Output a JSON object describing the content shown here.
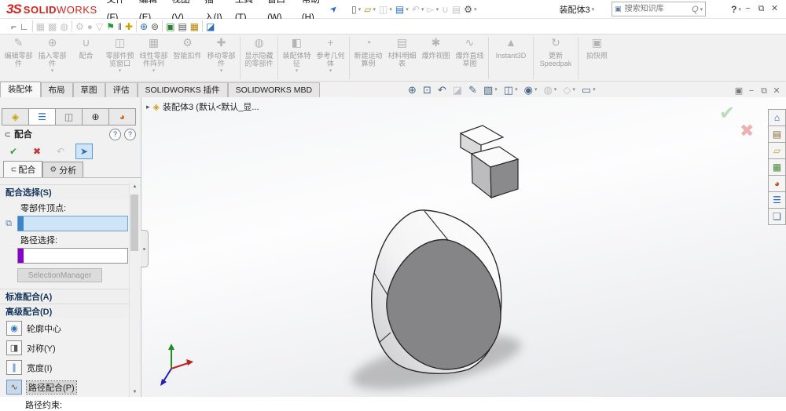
{
  "titlebar": {
    "logo_mark": "3S",
    "logo_text_solid": "SOLID",
    "logo_text_works": "WORKS",
    "menus": [
      "文件(F)",
      "编辑(E)",
      "视图(V)",
      "插入(I)",
      "工具(T)",
      "窗口(W)",
      "帮助(H)"
    ],
    "pin_glyph": "➤",
    "dropdown_glyph": "▾",
    "doc_button": "装配体3",
    "help_glyph": "?",
    "search": {
      "shield_glyph": "▣",
      "placeholder": "搜索知识库",
      "magnifier_glyph": "Q"
    },
    "quick_access": [
      {
        "name": "new-file-icon",
        "glyph": "▯",
        "color": "#666666",
        "dropdown": true
      },
      {
        "name": "open-file-icon",
        "glyph": "▱",
        "color": "#b8860b",
        "dropdown": true
      },
      {
        "name": "save-icon",
        "glyph": "◫",
        "disabled": true,
        "dropdown": true
      },
      {
        "name": "print-icon",
        "glyph": "▤",
        "color": "#2a6fb8",
        "dropdown": true
      },
      {
        "name": "undo-icon",
        "glyph": "↶",
        "disabled": true,
        "dropdown": true
      },
      {
        "name": "select-icon",
        "glyph": "▻",
        "disabled": true,
        "dropdown": true
      },
      {
        "name": "attach-icon",
        "glyph": "∪",
        "disabled": true
      },
      {
        "name": "properties-icon",
        "glyph": "▤",
        "disabled": true
      },
      {
        "name": "options-gear-icon",
        "glyph": "⚙",
        "color": "#555555",
        "dropdown": true
      }
    ],
    "window_controls": [
      {
        "name": "minimize-icon",
        "glyph": "−"
      },
      {
        "name": "restore-icon",
        "glyph": "⧉"
      },
      {
        "name": "close-icon",
        "glyph": "✕"
      }
    ]
  },
  "toolbar2": {
    "icons": [
      {
        "name": "mate-key-icon",
        "glyph": "⌐",
        "color": "#444444"
      },
      {
        "name": "angle-icon",
        "glyph": "∟",
        "color": "#444444"
      },
      {
        "sep": true
      },
      {
        "name": "component-icon",
        "glyph": "▦",
        "disabled": true
      },
      {
        "name": "pattern-icon",
        "glyph": "▩",
        "disabled": true
      },
      {
        "name": "sphere-icon",
        "glyph": "◍",
        "disabled": true
      },
      {
        "sep": true
      },
      {
        "name": "gear-icon",
        "glyph": "⚙",
        "disabled": true
      },
      {
        "name": "ball-icon",
        "glyph": "●",
        "disabled": true
      },
      {
        "name": "filter-icon",
        "glyph": "▽",
        "disabled": true
      },
      {
        "name": "location-pin-icon",
        "glyph": "⚑",
        "color": "#1f9d3a"
      },
      {
        "name": "measure-icon",
        "glyph": "‖",
        "color": "#555555"
      },
      {
        "name": "move-icon",
        "glyph": "✚",
        "color": "#c8a000"
      },
      {
        "sep": true
      },
      {
        "name": "zoom-icon",
        "glyph": "⊕",
        "color": "#2a6fb8"
      },
      {
        "name": "binoculars-icon",
        "glyph": "⊚",
        "color": "#555555"
      },
      {
        "sep": true
      },
      {
        "name": "export-icon",
        "glyph": "▣",
        "color": "#2e7d32"
      },
      {
        "name": "print-preview-icon",
        "glyph": "▤",
        "color": "#555555"
      },
      {
        "name": "image-icon",
        "glyph": "▦",
        "color": "#b8860b"
      },
      {
        "sep": true
      },
      {
        "name": "save-view-icon",
        "glyph": "◪",
        "color": "#2a6fb8"
      }
    ]
  },
  "ribbon": {
    "buttons": [
      {
        "name": "edit-component-button",
        "label": "编辑零部件",
        "glyph": "✎"
      },
      {
        "name": "insert-components-button",
        "label": "插入零部件",
        "glyph": "⊕",
        "dropdown": true
      },
      {
        "name": "mate-button",
        "label": "配合",
        "glyph": "∪"
      },
      {
        "name": "component-preview-button",
        "label": "零部件预览窗口",
        "glyph": "◫",
        "dropdown": true
      },
      {
        "name": "linear-pattern-button",
        "label": "线性零部件阵列",
        "glyph": "▦",
        "dropdown": true
      },
      {
        "name": "smart-fasteners-button",
        "label": "智能扣件",
        "glyph": "⚙"
      },
      {
        "name": "move-component-button",
        "label": "移动零部件",
        "glyph": "✚",
        "dropdown": true
      },
      {
        "sep": true
      },
      {
        "name": "show-hidden-components-button",
        "label": "显示隐藏的零部件",
        "glyph": "◍"
      },
      {
        "sep": true
      },
      {
        "name": "assembly-features-button",
        "label": "装配体特征",
        "glyph": "◧",
        "dropdown": true
      },
      {
        "name": "reference-geometry-button",
        "label": "参考几何体",
        "glyph": "+",
        "dropdown": true
      },
      {
        "sep": true
      },
      {
        "name": "new-motion-study-button",
        "label": "新建运动算例",
        "glyph": "◔"
      },
      {
        "name": "bom-button",
        "label": "材料明细表",
        "glyph": "▤"
      },
      {
        "name": "exploded-view-button",
        "label": "爆炸视图",
        "glyph": "✱"
      },
      {
        "name": "explode-line-sketch-button",
        "label": "爆炸直线草图",
        "glyph": "∿"
      },
      {
        "sep": true
      },
      {
        "name": "instant3d-button",
        "label": "Instant3D",
        "glyph": "▲",
        "wide": true
      },
      {
        "sep": true
      },
      {
        "name": "update-speedpak-button",
        "label": "更新 Speedpak",
        "glyph": "↻",
        "wide": true
      },
      {
        "sep": true
      },
      {
        "name": "take-snapshot-button",
        "label": "拍快照",
        "glyph": "▣"
      }
    ]
  },
  "command_tabs": [
    {
      "label": "装配体",
      "active": true
    },
    {
      "label": "布局"
    },
    {
      "label": "草图"
    },
    {
      "label": "评估"
    },
    {
      "label": "SOLIDWORKS 插件"
    },
    {
      "label": "SOLIDWORKS MBD"
    }
  ],
  "headsup": {
    "icons": [
      {
        "name": "zoom-fit-icon",
        "glyph": "⊕"
      },
      {
        "name": "zoom-area-icon",
        "glyph": "⊡"
      },
      {
        "name": "previous-view-icon",
        "glyph": "↶"
      },
      {
        "name": "section-view-icon",
        "glyph": "◪",
        "disabled": true
      },
      {
        "name": "edit-appearance-icon",
        "glyph": "✎"
      },
      {
        "name": "apply-scene-icon",
        "glyph": "▧",
        "dropdown": true
      },
      {
        "name": "display-style-icon",
        "glyph": "◫",
        "dropdown": true
      },
      {
        "name": "hide-show-items-icon",
        "glyph": "◉",
        "dropdown": true
      },
      {
        "name": "shadow-view-icon",
        "glyph": "◍",
        "disabled": true,
        "dropdown": true
      },
      {
        "name": "perspective-icon",
        "glyph": "◇",
        "disabled": true,
        "dropdown": true
      },
      {
        "name": "view-settings-icon",
        "glyph": "▭",
        "dropdown": true
      }
    ]
  },
  "doc_window_controls": [
    {
      "name": "expand-ribbon-icon",
      "glyph": "▣"
    },
    {
      "name": "minimize-doc-icon",
      "glyph": "−"
    },
    {
      "name": "restore-doc-icon",
      "glyph": "⧉"
    },
    {
      "name": "close-doc-icon",
      "glyph": "✕"
    }
  ],
  "property_manager": {
    "tabs": [
      {
        "name": "tab-feature-manager",
        "glyph": "◈",
        "color": "#c8a000"
      },
      {
        "name": "tab-property-manager",
        "glyph": "☰",
        "color": "#2a6fb8",
        "active": true
      },
      {
        "name": "tab-configuration-manager",
        "glyph": "◫",
        "color": "#777777"
      },
      {
        "name": "tab-dimxpert-manager",
        "glyph": "⊕",
        "color": "#333333"
      },
      {
        "name": "tab-display-manager",
        "glyph": "◕",
        "color": "#cc6622"
      }
    ],
    "title": "配合",
    "title_icon": "∪",
    "help_icons": [
      {
        "name": "whats-new-help-icon",
        "glyph": "?"
      },
      {
        "name": "help-icon",
        "glyph": "?"
      }
    ],
    "actions": [
      {
        "name": "confirm-button",
        "glyph": "✔",
        "color": "#3a9a3a"
      },
      {
        "name": "cancel-button",
        "glyph": "✖",
        "color": "#cc3333"
      },
      {
        "name": "undo-button",
        "glyph": "↶",
        "disabled": true
      },
      {
        "name": "keep-visible-pin-button",
        "glyph": "➤",
        "color": "#2a6fb8",
        "pressed": true
      }
    ],
    "subtabs": [
      {
        "label": "配合",
        "glyph": "∪",
        "active": true
      },
      {
        "label": "分析",
        "glyph": "⚙"
      }
    ],
    "mate_selection": {
      "header": "配合选择(S)",
      "chevron": "∧",
      "vertex_label": "零部件顶点:",
      "vertex_field_value": "",
      "path_label": "路径选择:",
      "path_field_value": "",
      "selection_button": "SelectionManager"
    },
    "standard_header": "标准配合(A)",
    "standard_chevron": "∨",
    "advanced_header": "高级配合(D)",
    "advanced_chevron": "∧",
    "advanced_items": [
      {
        "name": "profile-center-item",
        "label": "轮廓中心",
        "glyph": "◉",
        "color": "#2a6fb8"
      },
      {
        "name": "symmetric-item",
        "label": "对称(Y)",
        "glyph": "◨",
        "color": "#555555"
      },
      {
        "name": "width-item",
        "label": "宽度(I)",
        "glyph": "∥",
        "color": "#2a6fb8"
      },
      {
        "name": "path-mate-item",
        "label": "路径配合(P)",
        "glyph": "∿",
        "color": "#555555",
        "active": true
      }
    ],
    "path_constraint_label": "路径约束:"
  },
  "viewport": {
    "tree_arrow": "▸",
    "tree_icon": "◈",
    "tree_item_label": "装配体3 (默认<默认_显...",
    "confirm_glyph": "✔",
    "cancel_glyph": "✖"
  },
  "task_pane": {
    "icons": [
      {
        "name": "resources-home-icon",
        "glyph": "⌂",
        "color": "#1f5fa8"
      },
      {
        "name": "design-library-icon",
        "glyph": "▤",
        "color": "#8a6d3b"
      },
      {
        "name": "file-explorer-icon",
        "glyph": "▱",
        "color": "#c8a028"
      },
      {
        "name": "view-palette-icon",
        "glyph": "▦",
        "color": "#4a8a3a"
      },
      {
        "name": "appearances-icon",
        "glyph": "◕",
        "color": "#cc4422"
      },
      {
        "name": "custom-properties-icon",
        "glyph": "☰",
        "color": "#1f5fa8"
      },
      {
        "name": "forum-icon",
        "glyph": "❏",
        "color": "#4a6a8a"
      }
    ]
  },
  "scrollbar": {
    "up": "▲",
    "down": "▼"
  }
}
